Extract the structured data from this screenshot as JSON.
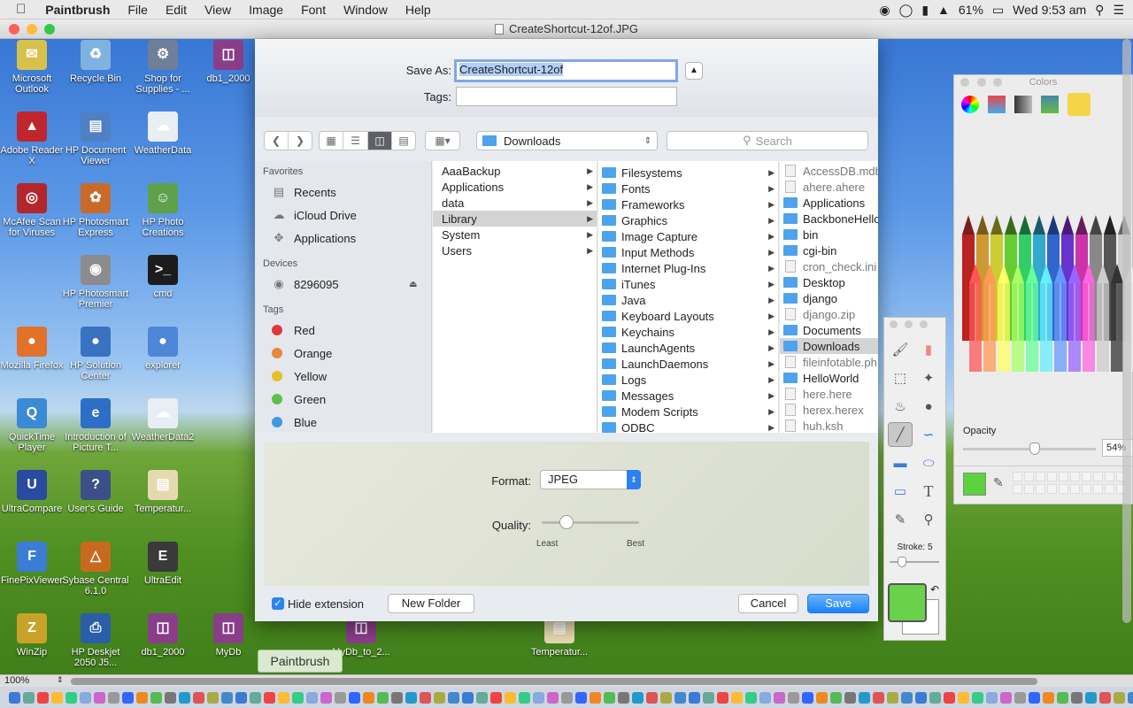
{
  "menubar": {
    "apple": "",
    "app_name": "Paintbrush",
    "items": [
      "File",
      "Edit",
      "View",
      "Image",
      "Font",
      "Window",
      "Help"
    ],
    "status": {
      "battery": "61%",
      "clock": "Wed 9:53 am"
    }
  },
  "window": {
    "title": "CreateShortcut-12of.JPG"
  },
  "desktop_icons": [
    {
      "label": "Microsoft Outlook",
      "color": "#d8c14a"
    },
    {
      "label": "Recycle Bin",
      "color": "#7fb2de"
    },
    {
      "label": "Shop for Supplies - ...",
      "color": "#6e7f99"
    },
    {
      "label": "db1_2000",
      "color": "#8a3e8a"
    },
    {
      "label": "Adobe Reader X",
      "color": "#c0262d"
    },
    {
      "label": "HP Document Viewer",
      "color": "#4f7fc4"
    },
    {
      "label": "WeatherData",
      "color": "#e9eef5"
    },
    {
      "label": "McAfee Scan for Viruses",
      "color": "#b3262b"
    },
    {
      "label": "HP Photosmart Express",
      "color": "#c96a2a"
    },
    {
      "label": "HP Photo Creations",
      "color": "#5fa04a"
    },
    {
      "label": "HP Photosmart Premier",
      "color": "#8c8c8c"
    },
    {
      "label": "cmd",
      "color": "#1c1c1c"
    },
    {
      "label": "Mozilla Firefox",
      "color": "#e0722a"
    },
    {
      "label": "HP Solution Center",
      "color": "#3a72c2"
    },
    {
      "label": "explorer",
      "color": "#4e86d8"
    },
    {
      "label": "QuickTime Player",
      "color": "#3a8bd6"
    },
    {
      "label": "Introduction of Picture T...",
      "color": "#2d6fc6"
    },
    {
      "label": "WeatherData2",
      "color": "#e9eef5"
    },
    {
      "label": "UltraCompare",
      "color": "#2a4aa0"
    },
    {
      "label": "User's Guide",
      "color": "#3c4f88"
    },
    {
      "label": "Temperatur...",
      "color": "#e6d9b0"
    },
    {
      "label": "FinePixViewer",
      "color": "#3b7cd4"
    },
    {
      "label": "Sybase Central 6.1.0",
      "color": "#c86a1e"
    },
    {
      "label": "UltraEdit",
      "color": "#3a3a3a"
    },
    {
      "label": "WinZip",
      "color": "#c9a22a"
    },
    {
      "label": "HP Deskjet 2050 J5...",
      "color": "#2a5fa8"
    },
    {
      "label": "db1_2000",
      "color": "#8a3e8a"
    },
    {
      "label": "MyDb",
      "color": "#8a3e8a"
    },
    {
      "label": "MyDb_to_2...",
      "color": "#8a3e8a"
    },
    {
      "label": "Temperatur...",
      "color": "#e6d9b0"
    }
  ],
  "save_dialog": {
    "save_as_label": "Save As:",
    "save_as_value": "CreateShortcut-12of",
    "tags_label": "Tags:",
    "tags_value": "",
    "location": "Downloads",
    "search_placeholder": "Search",
    "sidebar": {
      "favorites_header": "Favorites",
      "favorites": [
        "Recents",
        "iCloud Drive",
        "Applications"
      ],
      "devices_header": "Devices",
      "devices": [
        "8296095"
      ],
      "tags_header": "Tags",
      "tags": [
        {
          "name": "Red",
          "color": "#e0383e"
        },
        {
          "name": "Orange",
          "color": "#e7883a"
        },
        {
          "name": "Yellow",
          "color": "#e4c02d"
        },
        {
          "name": "Green",
          "color": "#5fbf4a"
        },
        {
          "name": "Blue",
          "color": "#3d9ae0"
        }
      ]
    },
    "col1": [
      {
        "name": "AaaBackup",
        "sel": false
      },
      {
        "name": "Applications",
        "sel": false
      },
      {
        "name": "data",
        "sel": false
      },
      {
        "name": "Library",
        "sel": true
      },
      {
        "name": "System",
        "sel": false
      },
      {
        "name": "Users",
        "sel": false
      }
    ],
    "col2": [
      "Filesystems",
      "Fonts",
      "Frameworks",
      "Graphics",
      "Image Capture",
      "Input Methods",
      "Internet Plug-Ins",
      "iTunes",
      "Java",
      "Keyboard Layouts",
      "Keychains",
      "LaunchAgents",
      "LaunchDaemons",
      "Logs",
      "Messages",
      "Modem Scripts",
      "ODBC"
    ],
    "col3": [
      {
        "name": "AccessDB.mdb",
        "folder": false,
        "gray": true
      },
      {
        "name": "ahere.ahere",
        "folder": false,
        "gray": true
      },
      {
        "name": "Applications",
        "folder": true,
        "gray": false
      },
      {
        "name": "BackboneHello",
        "folder": true,
        "gray": false
      },
      {
        "name": "bin",
        "folder": true,
        "gray": false
      },
      {
        "name": "cgi-bin",
        "folder": true,
        "gray": false
      },
      {
        "name": "cron_check.ini",
        "folder": false,
        "gray": true
      },
      {
        "name": "Desktop",
        "folder": true,
        "gray": false
      },
      {
        "name": "django",
        "folder": true,
        "gray": false
      },
      {
        "name": "django.zip",
        "folder": false,
        "gray": true
      },
      {
        "name": "Documents",
        "folder": true,
        "gray": false
      },
      {
        "name": "Downloads",
        "folder": true,
        "gray": false,
        "sel": true
      },
      {
        "name": "fileinfotable.ph",
        "folder": false,
        "gray": true
      },
      {
        "name": "HelloWorld",
        "folder": true,
        "gray": false
      },
      {
        "name": "here.here",
        "folder": false,
        "gray": true
      },
      {
        "name": "herex.herex",
        "folder": false,
        "gray": true
      },
      {
        "name": "huh.ksh",
        "folder": false,
        "gray": true
      }
    ],
    "format_label": "Format:",
    "format_value": "JPEG",
    "quality_label": "Quality:",
    "quality_min": "Least",
    "quality_max": "Best",
    "quality_level": 0.25,
    "hide_extension_label": "Hide extension",
    "hide_extension_checked": true,
    "new_folder": "New Folder",
    "cancel": "Cancel",
    "save": "Save"
  },
  "colors_panel": {
    "title": "Colors",
    "opacity_label": "Opacity",
    "opacity_value": "54%",
    "opacity_level": 0.54,
    "current_color": "#5dd23e"
  },
  "tools_panel": {
    "stroke_label": "Stroke: 5",
    "stroke_level": 0.25,
    "fg_color": "#6ad24a"
  },
  "tooltip": "Paintbrush",
  "status": {
    "zoom": "100%"
  }
}
